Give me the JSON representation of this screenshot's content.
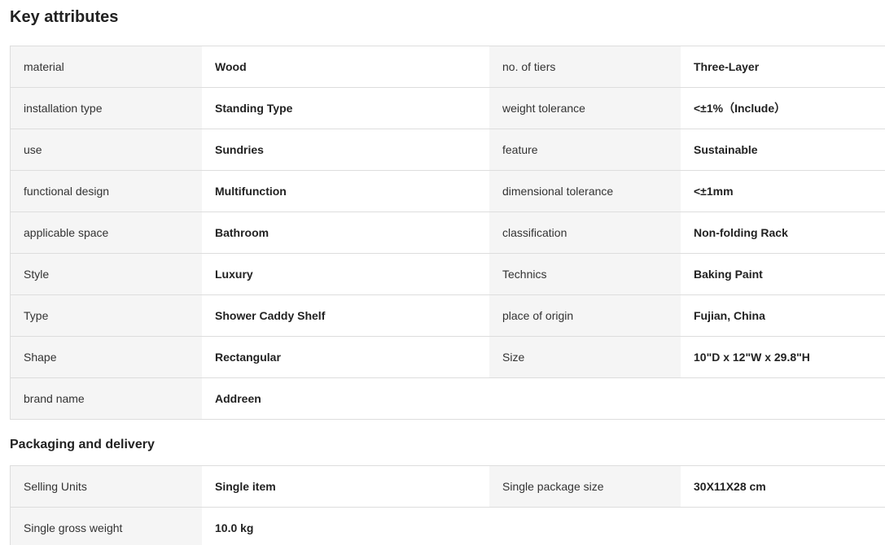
{
  "key_attributes": {
    "title": "Key attributes",
    "rows": [
      {
        "label1": "material",
        "value1": "Wood",
        "label2": "no. of tiers",
        "value2": "Three-Layer"
      },
      {
        "label1": "installation type",
        "value1": "Standing Type",
        "label2": "weight tolerance",
        "value2": "<±1%（Include）"
      },
      {
        "label1": "use",
        "value1": "Sundries",
        "label2": "feature",
        "value2": "Sustainable"
      },
      {
        "label1": "functional design",
        "value1": "Multifunction",
        "label2": "dimensional tolerance",
        "value2": "<±1mm"
      },
      {
        "label1": "applicable space",
        "value1": "Bathroom",
        "label2": "classification",
        "value2": "Non-folding Rack"
      },
      {
        "label1": "Style",
        "value1": "Luxury",
        "label2": "Technics",
        "value2": "Baking Paint"
      },
      {
        "label1": "Type",
        "value1": "Shower Caddy Shelf",
        "label2": "place of origin",
        "value2": "Fujian, China"
      },
      {
        "label1": "Shape",
        "value1": "Rectangular",
        "label2": "Size",
        "value2": "10\"D x 12\"W x 29.8\"H"
      },
      {
        "label1": "brand name",
        "value1": "Addreen"
      }
    ]
  },
  "packaging": {
    "title": "Packaging and delivery",
    "rows": [
      {
        "label1": "Selling Units",
        "value1": "Single item",
        "label2": "Single package size",
        "value2": "30X11X28 cm"
      },
      {
        "label1": "Single gross weight",
        "value1": "10.0 kg"
      }
    ]
  }
}
